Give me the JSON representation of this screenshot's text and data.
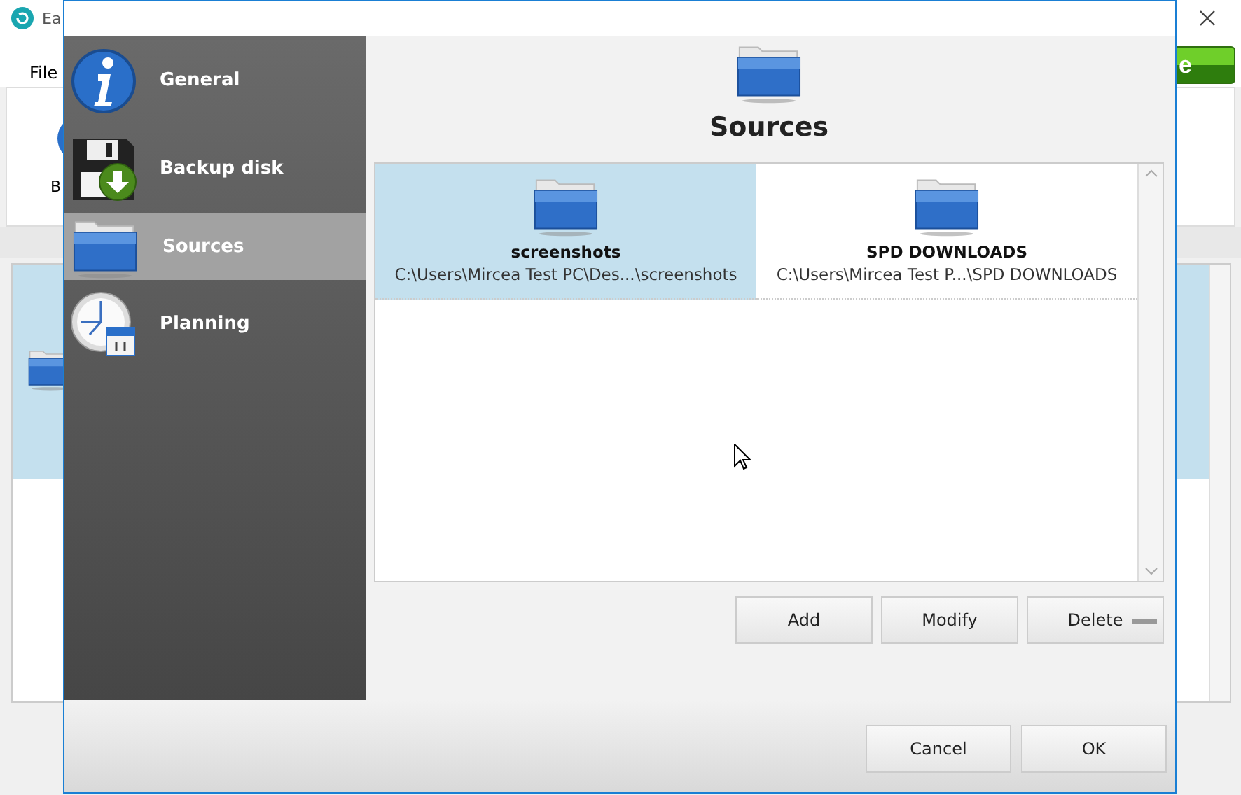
{
  "background_window": {
    "title": "Ea",
    "menu": [
      "File"
    ],
    "toolbar_label": "B",
    "action_button": "e"
  },
  "dialog": {
    "sidebar": [
      {
        "label": "General",
        "kind": "info",
        "selected": false
      },
      {
        "label": "Backup disk",
        "kind": "floppy",
        "selected": false
      },
      {
        "label": "Sources",
        "kind": "folder",
        "selected": true
      },
      {
        "label": "Planning",
        "kind": "clock",
        "selected": false
      }
    ],
    "heading": "Sources",
    "sources": [
      {
        "name": "screenshots",
        "path": "C:\\Users\\Mircea Test PC\\Des...\\screenshots",
        "selected": true
      },
      {
        "name": "SPD DOWNLOADS",
        "path": "C:\\Users\\Mircea Test P...\\SPD DOWNLOADS",
        "selected": false
      }
    ],
    "buttons": [
      {
        "label": "Add",
        "kind": "plain"
      },
      {
        "label": "Modify",
        "kind": "plain"
      },
      {
        "label": "Delete",
        "kind": "menu"
      }
    ],
    "footer_buttons": [
      "Cancel",
      "OK"
    ]
  }
}
